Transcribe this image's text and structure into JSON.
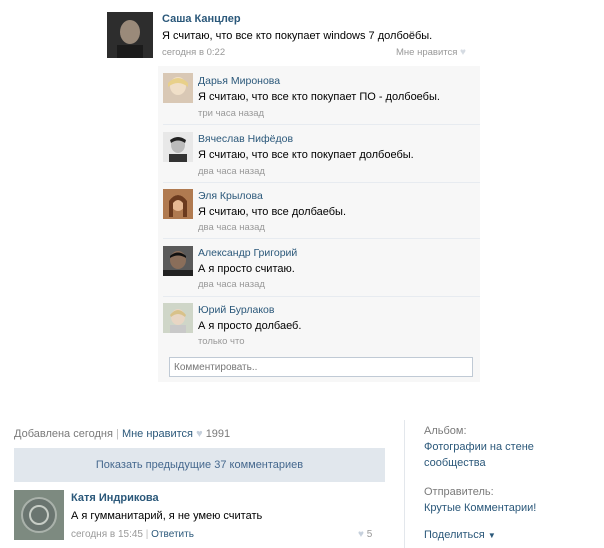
{
  "post": {
    "author": "Саша Канцлер",
    "text": "Я считаю, что все кто покупает windows 7 долбоёбы.",
    "time": "сегодня в 0:22",
    "like_label": "Мне нравится",
    "heart_icon": "heart-icon"
  },
  "comments": [
    {
      "name": "Дарья Миронова",
      "text": "Я считаю, что все кто покупает ПО - долбоебы.",
      "time": "три часа назад"
    },
    {
      "name": "Вячеслав Нифёдов",
      "text": "Я считаю, что все кто покупает долбоебы.",
      "time": "два часа назад"
    },
    {
      "name": "Эля Крылова",
      "text": "Я считаю, что все долбаебы.",
      "time": "два часа назад"
    },
    {
      "name": "Александр Григорий",
      "text": "А я просто считаю.",
      "time": "два часа назад"
    },
    {
      "name": "Юрий Бурлаков",
      "text": "А я просто долбаеб.",
      "time": "только что"
    }
  ],
  "comment_input": {
    "placeholder": "Комментировать.."
  },
  "footer": {
    "added": "Добавлена сегодня",
    "separator": "|",
    "like_label": "Мне нравится",
    "like_count": "1991",
    "show_previous": "Показать предыдущие 37 комментариев"
  },
  "bottom_comment": {
    "name": "Катя Индрикова",
    "text": "А я гумманитарий, я не умею считать",
    "time": "сегодня в 15:45",
    "separator": "|",
    "reply": "Ответить",
    "likes": "5"
  },
  "sidebar": {
    "album_label": "Альбом:",
    "album_name_line1": "Фотографии на стене",
    "album_name_line2": "сообщества",
    "sender_label": "Отправитель:",
    "sender_name": "Крутые Комментарии!",
    "share": "Поделиться"
  },
  "colors": {
    "link": "#2b587a",
    "muted": "#999999",
    "heart": "#c6d0dc",
    "button_bg": "#e1e7ed"
  }
}
